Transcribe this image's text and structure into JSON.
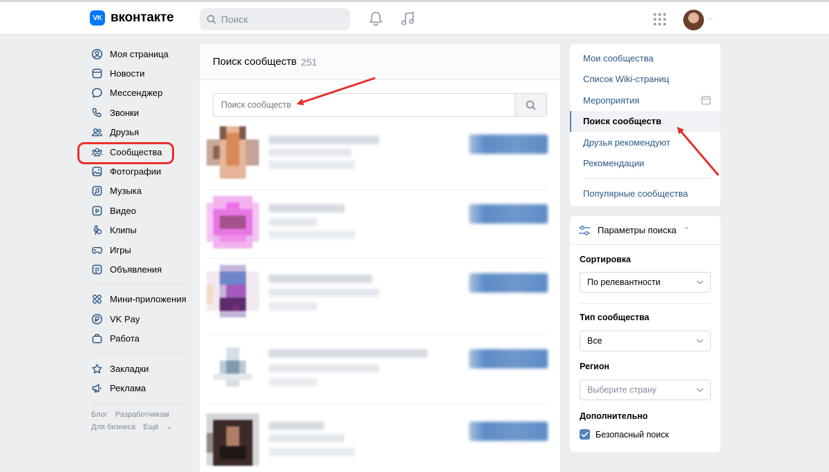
{
  "header": {
    "logo_text": "вконтакте",
    "logo_mark": "VK",
    "search_placeholder": "Поиск",
    "icons": [
      "bell-icon",
      "music-icon",
      "apps-grid-icon",
      "chevron-down-icon"
    ]
  },
  "nav": {
    "items": [
      {
        "label": "Моя страница",
        "icon": "user-circle-icon"
      },
      {
        "label": "Новости",
        "icon": "news-icon"
      },
      {
        "label": "Мессенджер",
        "icon": "message-icon"
      },
      {
        "label": "Звонки",
        "icon": "phone-icon"
      },
      {
        "label": "Друзья",
        "icon": "friends-icon"
      },
      {
        "label": "Сообщества",
        "icon": "communities-icon",
        "highlighted": true
      },
      {
        "label": "Фотографии",
        "icon": "photo-icon"
      },
      {
        "label": "Музыка",
        "icon": "music-icon"
      },
      {
        "label": "Видео",
        "icon": "video-icon"
      },
      {
        "label": "Клипы",
        "icon": "clips-icon"
      },
      {
        "label": "Игры",
        "icon": "gamepad-icon"
      },
      {
        "label": "Объявления",
        "icon": "ads-board-icon"
      }
    ],
    "items2": [
      {
        "label": "Мини-приложения",
        "icon": "apps-icon"
      },
      {
        "label": "VK Pay",
        "icon": "vkpay-icon"
      },
      {
        "label": "Работа",
        "icon": "briefcase-icon"
      }
    ],
    "items3": [
      {
        "label": "Закладки",
        "icon": "star-icon"
      },
      {
        "label": "Реклама",
        "icon": "megaphone-icon"
      }
    ],
    "footer": {
      "blog": "Блог",
      "developers": "Разработчикам",
      "business": "Для бизнеса",
      "more": "Ещё"
    }
  },
  "main": {
    "title": "Поиск сообществ",
    "count": "251",
    "search_placeholder": "Поиск сообществ"
  },
  "right_menu": {
    "items": [
      {
        "label": "Мои сообщества"
      },
      {
        "label": "Список Wiki-страниц"
      },
      {
        "label": "Мероприятия"
      },
      {
        "label": "Поиск сообществ",
        "active": true
      },
      {
        "label": "Друзья рекомендуют"
      },
      {
        "label": "Рекомендации"
      }
    ],
    "popular": "Популярные сообщества"
  },
  "filters": {
    "title": "Параметры поиска",
    "sort_label": "Сортировка",
    "sort_value": "По релевантности",
    "type_label": "Тип сообщества",
    "type_value": "Все",
    "region_label": "Регион",
    "region_placeholder": "Выберите страну",
    "extra_label": "Дополнительно",
    "safe_search_label": "Безопасный поиск",
    "safe_search_checked": true
  },
  "colors": {
    "accent": "#0077ff",
    "link": "#2a5885",
    "highlight": "#e8302d"
  }
}
